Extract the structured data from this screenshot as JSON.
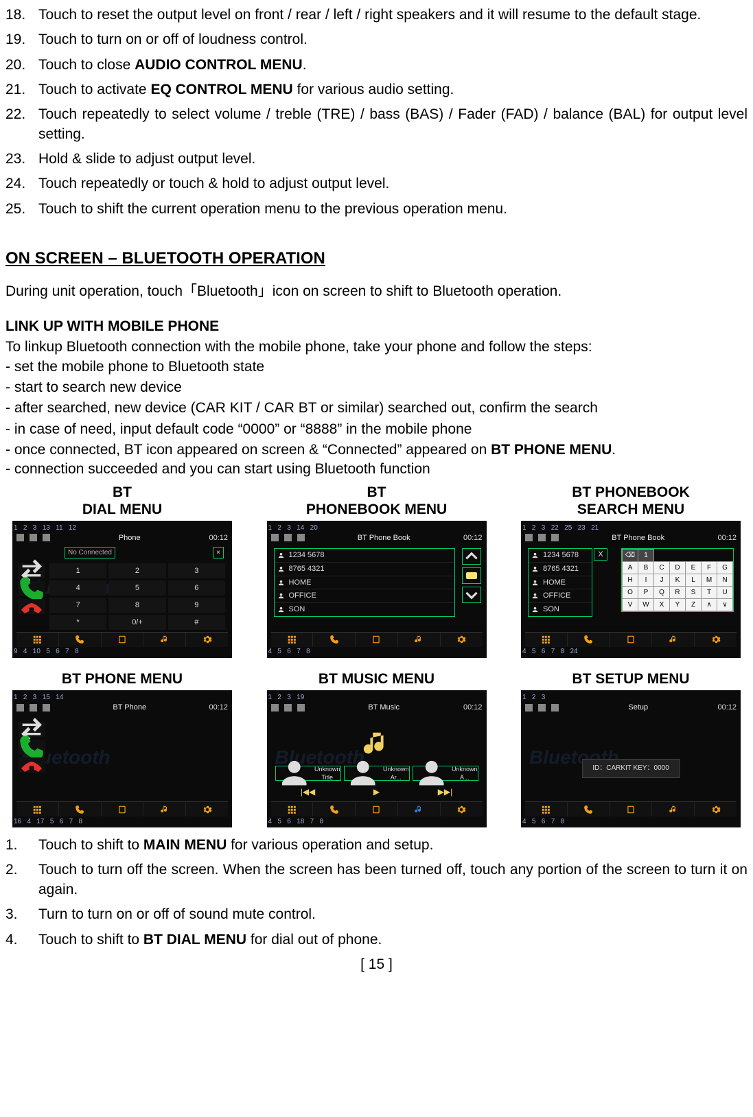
{
  "top_list": [
    {
      "n": "18.",
      "t": "Touch to reset the output level on front / rear / left / right speakers and it will resume to the default stage."
    },
    {
      "n": "19.",
      "t": "Touch to turn on or off of loudness control."
    },
    {
      "n": "20.",
      "before": "Touch to close ",
      "bold": "AUDIO CONTROL MENU",
      "after": "."
    },
    {
      "n": "21.",
      "before": "Touch to activate ",
      "bold": "EQ CONTROL MENU",
      "after": " for various audio setting."
    },
    {
      "n": "22.",
      "t": "Touch repeatedly to select volume / treble (TRE) / bass (BAS) / Fader (FAD) / balance (BAL) for output level setting."
    },
    {
      "n": "23.",
      "t": "Hold & slide to adjust output level."
    },
    {
      "n": "24.",
      "t": "Touch repeatedly or touch & hold to adjust output level."
    },
    {
      "n": "25.",
      "t": "Touch to shift the current operation menu to the previous operation menu."
    }
  ],
  "section_heading": "ON SCREEN – BLUETOOTH OPERATION",
  "intro": "During unit operation, touch「Bluetooth」icon on screen to shift to Bluetooth operation.",
  "link_heading": "LINK UP WITH MOBILE PHONE",
  "link_intro": "To linkup Bluetooth connection with the mobile phone, take your phone and follow the steps:",
  "link_steps": [
    "- set the mobile phone to Bluetooth state",
    "- start to search new device",
    "- after searched, new device (CAR KIT / CAR BT or similar) searched out, confirm the search",
    "- in case of need, input default code “0000” or “8888” in the mobile phone"
  ],
  "link_connected_before": "- once connected, BT icon appeared on screen & “Connected” appeared on ",
  "link_connected_bold": "BT PHONE MENU",
  "link_connected_after": ".",
  "link_last": "- connection succeeded and you can start using Bluetooth function",
  "menu_titles": {
    "dial": "BT\nDIAL MENU",
    "pb": "BT\nPHONEBOOK MENU",
    "pbs": "BT PHONEBOOK\nSEARCH MENU",
    "phone": "BT PHONE MENU",
    "music": "BT MUSIC MENU",
    "setup": "BT SETUP MENU"
  },
  "callouts": {
    "dial_top": [
      "1",
      "2",
      "3",
      "13",
      "11",
      "12"
    ],
    "dial_bottom": [
      "9",
      "4",
      "10",
      "5",
      "6",
      "7",
      "8"
    ],
    "pb_top": [
      "1",
      "2",
      "3",
      "14",
      "20"
    ],
    "pb_bottom": [
      "4",
      "5",
      "6",
      "7",
      "8"
    ],
    "pbs_top": [
      "1",
      "2",
      "3",
      "22",
      "25",
      "23",
      "21"
    ],
    "pbs_bottom": [
      "4",
      "5",
      "6",
      "7",
      "8",
      "24"
    ],
    "phone_top": [
      "1",
      "2",
      "3",
      "15",
      "14"
    ],
    "phone_bottom": [
      "16",
      "4",
      "17",
      "5",
      "6",
      "7",
      "8"
    ],
    "music_top": [
      "1",
      "2",
      "3",
      "19"
    ],
    "music_bottom": [
      "4",
      "5",
      "6",
      "18",
      "7",
      "8"
    ],
    "setup_top": [
      "1",
      "2",
      "3"
    ],
    "setup_bottom": [
      "4",
      "5",
      "6",
      "7",
      "8"
    ]
  },
  "screens": {
    "time": "00:12",
    "watermark": "Bluetooth",
    "dial": {
      "title": "Phone",
      "status": "No Connected",
      "close": "×",
      "keys": [
        "1",
        "2",
        "3",
        "4",
        "5",
        "6",
        "7",
        "8",
        "9",
        "*",
        "0/+",
        "#"
      ]
    },
    "phonebook": {
      "title": "BT Phone Book",
      "entries": [
        "1234 5678",
        "8765 4321",
        "HOME",
        "OFFICE",
        "SON"
      ]
    },
    "search": {
      "title": "BT Phone Book",
      "x": "X",
      "cols": [
        [
          "A",
          "B",
          "C",
          "D",
          "E",
          "F",
          "G"
        ],
        [
          "H",
          "I",
          "J",
          "K",
          "L",
          "M",
          "N"
        ],
        [
          "O",
          "P",
          "Q",
          "R",
          "S",
          "T",
          "U"
        ],
        [
          "V",
          "W",
          "X",
          "Y",
          "Z",
          "∧",
          "∨"
        ]
      ],
      "side": [
        "⌫",
        "1"
      ]
    },
    "phone": {
      "title": "BT Phone"
    },
    "music": {
      "title": "BT Music",
      "tags": [
        "Unknown Title",
        "Unknown Ar...",
        "Unknown A..."
      ],
      "ctrls": [
        "|◀◀",
        "▶",
        "▶▶|"
      ]
    },
    "setup": {
      "title": "Setup",
      "info": "ID：CARKIT  KEY：0000"
    }
  },
  "bottom_list": [
    {
      "n": "1.",
      "before": "Touch to shift to ",
      "bold": "MAIN MENU",
      "after": " for various operation and setup."
    },
    {
      "n": "2.",
      "t": "Touch to turn off the screen. When the screen has been turned off, touch any portion of the screen to turn it on again."
    },
    {
      "n": "3.",
      "t": "Turn to turn on or off of sound mute control."
    },
    {
      "n": "4.",
      "before": "Touch to shift to ",
      "bold": "BT DIAL MENU",
      "after": " for dial out of phone."
    }
  ],
  "page_number": "[ 15 ]"
}
